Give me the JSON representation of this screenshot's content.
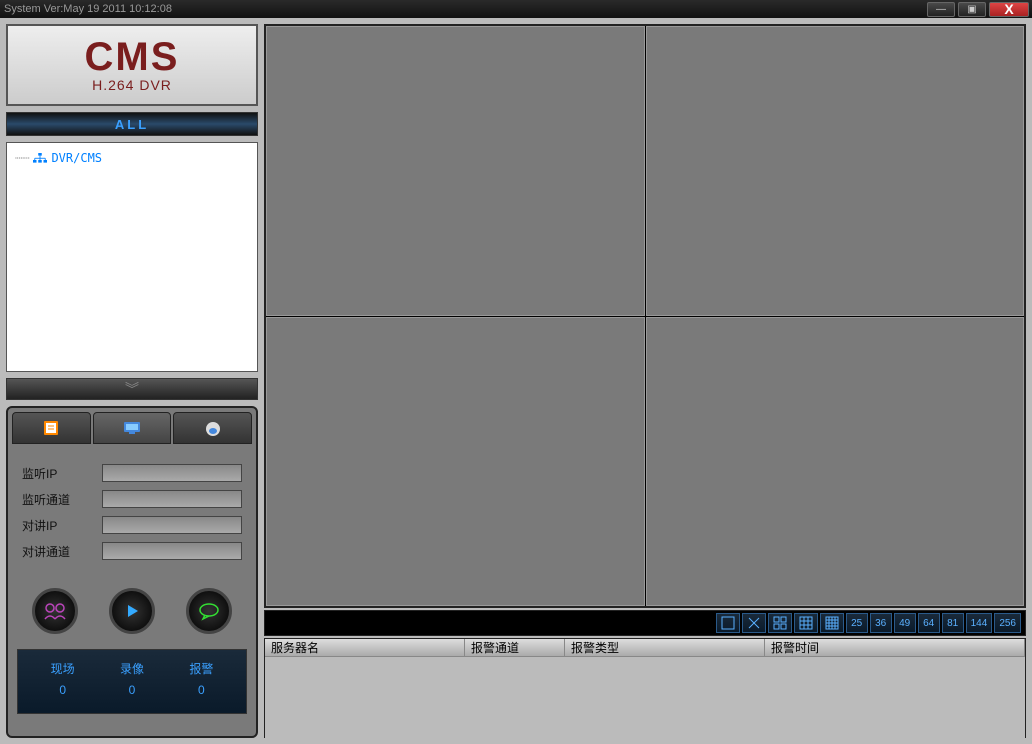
{
  "titlebar": {
    "text": "System Ver:May 19 2011 10:12:08"
  },
  "logo": {
    "title": "CMS",
    "subtitle": "H.264 DVR"
  },
  "sidebar": {
    "all_label": "ALL",
    "tree_item": "DVR/CMS"
  },
  "form": {
    "listen_ip": "监听IP",
    "listen_channel": "监听通道",
    "talk_ip": "对讲IP",
    "talk_channel": "对讲通道"
  },
  "status": {
    "labels": {
      "live": "现场",
      "record": "录像",
      "alarm": "报警"
    },
    "values": {
      "live": "0",
      "record": "0",
      "alarm": "0"
    }
  },
  "toolbar": {
    "buttons": [
      "25",
      "36",
      "49",
      "64",
      "81",
      "144",
      "256"
    ]
  },
  "alarm_table": {
    "cols": {
      "server": "服务器名",
      "channel": "报警通道",
      "type": "报警类型",
      "time": "报警时间"
    }
  }
}
